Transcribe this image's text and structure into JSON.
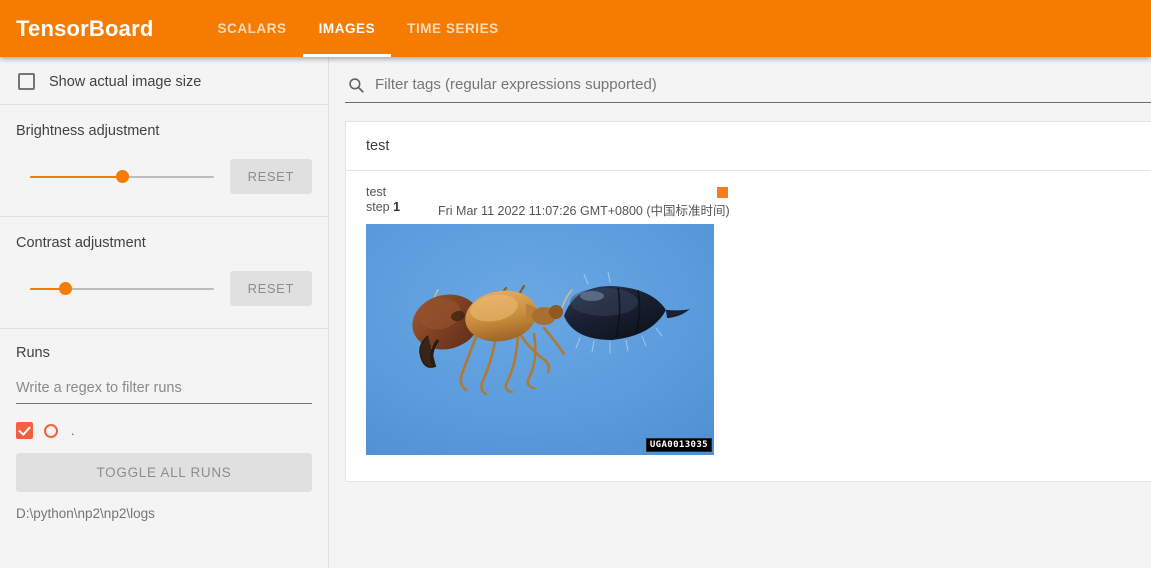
{
  "header": {
    "brand": "TensorBoard",
    "tabs": [
      {
        "label": "SCALARS",
        "active": false
      },
      {
        "label": "IMAGES",
        "active": true
      },
      {
        "label": "TIME SERIES",
        "active": false
      }
    ]
  },
  "sidebar": {
    "show_actual_size": {
      "label": "Show actual image size",
      "checked": false
    },
    "brightness": {
      "label": "Brightness adjustment",
      "reset_label": "RESET",
      "value_percent": 50
    },
    "contrast": {
      "label": "Contrast adjustment",
      "reset_label": "RESET",
      "value_percent": 19
    },
    "runs": {
      "title": "Runs",
      "filter_placeholder": "Write a regex to filter runs",
      "filter_value": "",
      "items": [
        {
          "label": ".",
          "checked": true,
          "color": "#f4603e"
        }
      ],
      "toggle_all_label": "TOGGLE ALL RUNS",
      "log_path": "D:\\python\\np2\\np2\\logs"
    }
  },
  "main": {
    "tag_filter": {
      "placeholder": "Filter tags (regular expressions supported)",
      "value": "",
      "icon": "search-icon"
    },
    "tag_groups": [
      {
        "name": "test",
        "cards": [
          {
            "run": "test",
            "step_label": "step",
            "step_value": "1",
            "timestamp": "Fri Mar 11 2022 11:07:26 GMT+0800 (中国标准时间)",
            "run_color": "#f57c20",
            "image_watermark": "UGA0013035",
            "image_alt": "ant-photograph"
          }
        ]
      }
    ]
  },
  "colors": {
    "brand_orange": "#f57c00",
    "run_orange": "#f4603e",
    "image_background": "#5a9bdc"
  }
}
